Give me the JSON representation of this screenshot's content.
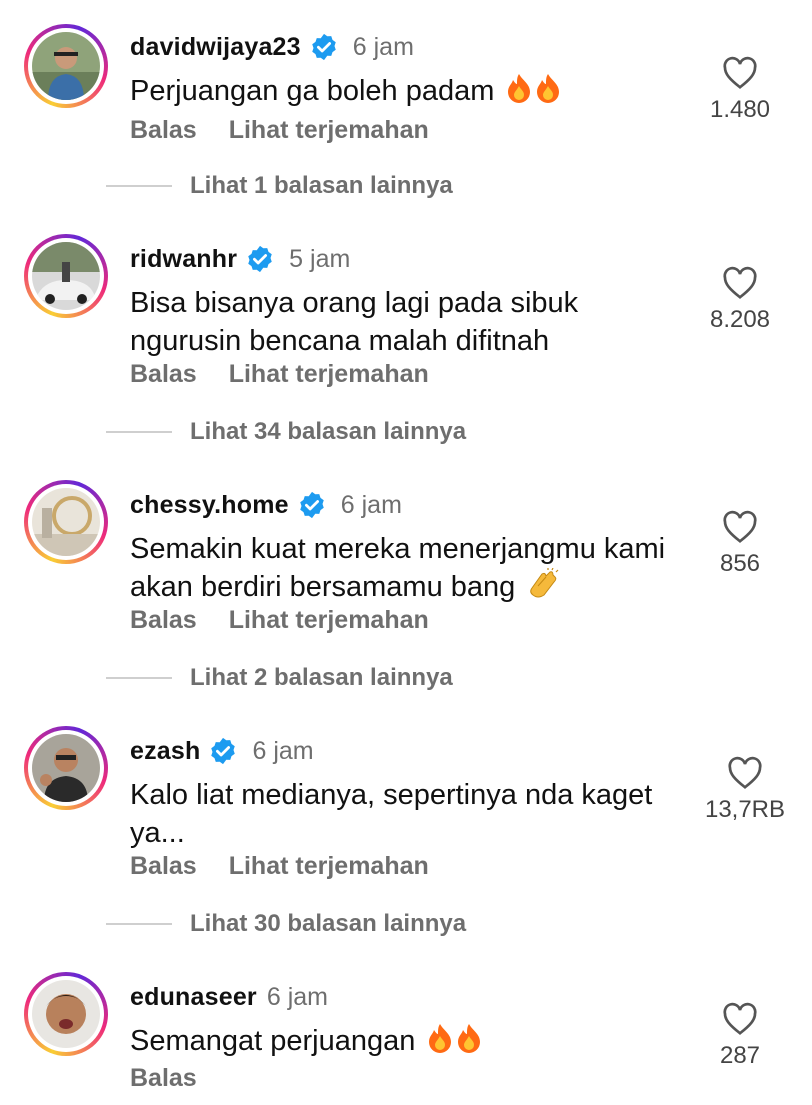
{
  "comments": [
    {
      "username": "davidwijaya23",
      "verified": true,
      "time": "6 jam",
      "text": "Perjuangan ga boleh padam",
      "emoji": "fire-fire",
      "reply_label": "Balas",
      "translate_label": "Lihat terjemahan",
      "likes": "1.480",
      "view_replies": "Lihat 1 balasan lainnya"
    },
    {
      "username": "ridwanhr",
      "verified": true,
      "time": "5 jam",
      "text": "Bisa bisanya orang lagi pada sibuk ngurusin bencana malah difitnah",
      "emoji": "",
      "reply_label": "Balas",
      "translate_label": "Lihat terjemahan",
      "likes": "8.208",
      "view_replies": "Lihat 34 balasan lainnya"
    },
    {
      "username": "chessy.home",
      "verified": true,
      "time": "6 jam",
      "text": "Semakin kuat mereka menerjangmu kami akan berdiri bersamamu bang",
      "emoji": "clapping-hands",
      "reply_label": "Balas",
      "translate_label": "Lihat terjemahan",
      "likes": "856",
      "view_replies": "Lihat 2 balasan lainnya"
    },
    {
      "username": "ezash",
      "verified": true,
      "time": "6 jam",
      "text": "Kalo liat medianya, sepertinya nda kaget ya...",
      "emoji": "",
      "reply_label": "Balas",
      "translate_label": "Lihat terjemahan",
      "likes": "13,7RB",
      "view_replies": "Lihat 30 balasan lainnya"
    },
    {
      "username": "edunaseer",
      "verified": false,
      "time": "6 jam",
      "text": "Semangat perjuangan",
      "emoji": "fire-fire",
      "reply_label": "Balas",
      "likes": "287"
    }
  ],
  "colors": {
    "verified": "#1d9bf0",
    "muted": "#6e6e6e",
    "text": "#111111",
    "fire": "#ff6a13"
  }
}
